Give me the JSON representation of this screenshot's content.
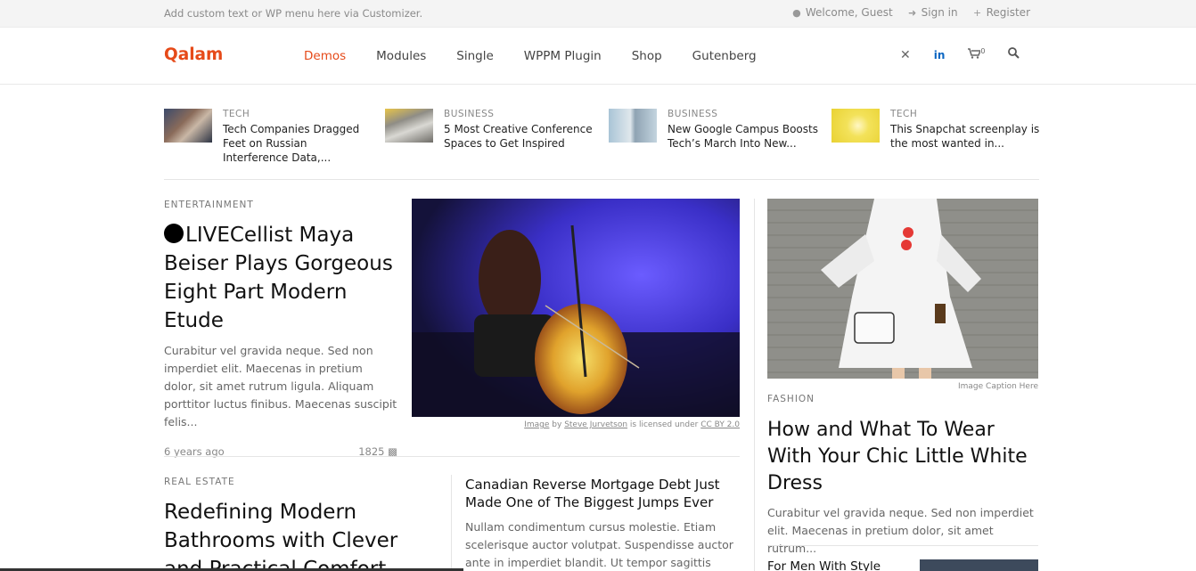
{
  "topbar": {
    "tagline": "Add custom text or WP menu here via Customizer.",
    "welcome": "Welcome, Guest",
    "signin": "Sign in",
    "register": "Register"
  },
  "header": {
    "logo": "Qalam",
    "nav": [
      "Demos",
      "Modules",
      "Single",
      "WPPM Plugin",
      "Shop",
      "Gutenberg"
    ],
    "cart_count": "0",
    "accent": "#e64a19"
  },
  "ticker": [
    {
      "cat": "TECH",
      "title": "Tech Companies Dragged Feet on Russian Interference Data,..."
    },
    {
      "cat": "BUSINESS",
      "title": "5 Most Creative Conference Spaces to Get Inspired"
    },
    {
      "cat": "BUSINESS",
      "title": "New Google Campus Boosts Tech’s March Into New..."
    },
    {
      "cat": "TECH",
      "title": "This Snapchat screenplay is the most wanted in..."
    }
  ],
  "lead": {
    "cat": "ENTERTAINMENT",
    "title": "LIVECellist Maya Beiser Plays Gorgeous Eight Part Modern Etude",
    "excerpt": "Curabitur vel gravida neque. Sed non imperdiet elit. Maecenas in pretium dolor, sit amet rutrum ligula. Aliquam porttitor luctus finibus. Maecenas suscipit felis...",
    "time": "6 years ago",
    "views": "1825"
  },
  "credit": {
    "image": "Image",
    "by": "by",
    "author": "Steve Jurvetson",
    "licensed": "is licensed under",
    "license": "CC BY 2.0"
  },
  "realestate": {
    "cat": "REAL ESTATE",
    "title": "Redefining Modern Bathrooms with Clever and Practical Comfort"
  },
  "canada": {
    "title": "Canadian Reverse Mortgage Debt Just Made One of The Biggest Jumps Ever",
    "excerpt": "Nullam condimentum cursus molestie. Etiam scelerisque auctor volutpat. Suspendisse auctor ante in imperdiet blandit. Ut tempor sagittis lorem"
  },
  "fashion": {
    "caption": "Image Caption Here",
    "cat": "FASHION",
    "title": "How and What To Wear With Your Chic Little White Dress",
    "excerpt": "Curabitur vel gravida neque. Sed non imperdiet elit. Maecenas in pretium dolor, sit amet rutrum..."
  },
  "formen": "For Men With Style"
}
